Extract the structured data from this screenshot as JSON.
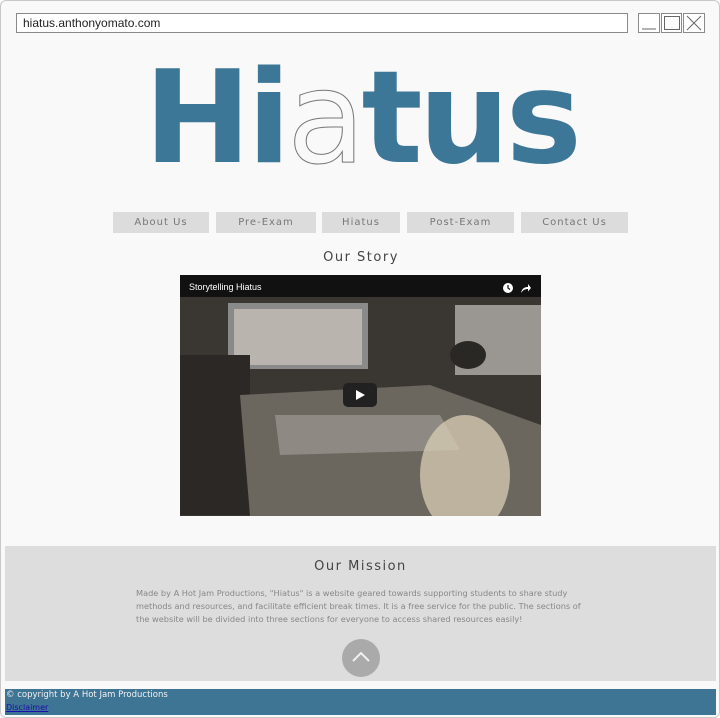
{
  "browser": {
    "url": "hiatus.anthonyomato.com"
  },
  "logo": {
    "left": "Hi",
    "hollow": "a",
    "right": "tus"
  },
  "nav": {
    "items": [
      "About Us",
      "Pre-Exam",
      "Hiatus",
      "Post-Exam",
      "Contact Us"
    ]
  },
  "story": {
    "title": "Our Story"
  },
  "video": {
    "title": "Storytelling Hiatus"
  },
  "mission": {
    "title": "Our Mission",
    "text": "Made by A Hot Jam Productions, \"Hiatus\" is a website geared towards supporting students to share study methods and resources, and facilitate efficient break times. It is a free service for the public. The sections of the website will be divided into three sections for everyone to access shared resources easily!"
  },
  "footer": {
    "copyright": "© copyright by A Hot Jam Productions",
    "disclaimer": "Disclaimer"
  },
  "colors": {
    "brand": "#3d7797",
    "footer": "#3e7494",
    "nav_bg": "#dcdcdc",
    "mission_bg": "#dddddd"
  }
}
